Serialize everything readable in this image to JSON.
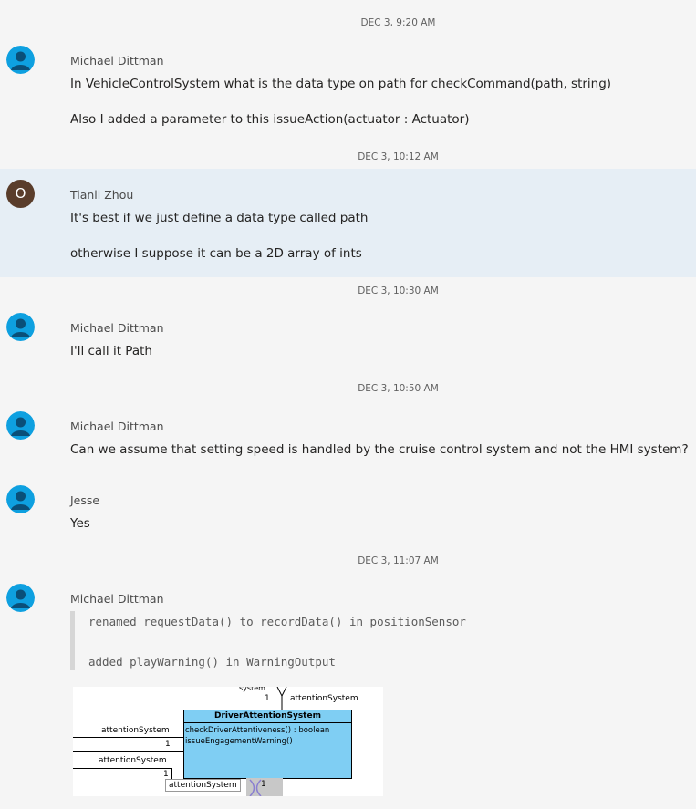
{
  "messages": [
    {
      "timestamp": "DEC 3, 9:20 AM",
      "author": "Michael Dittman",
      "lines": [
        "In VehicleControlSystem what is the data type on path for checkCommand(path, string)",
        "Also I added a parameter to this issueAction(actuator : Actuator)"
      ]
    },
    {
      "timestamp": "DEC 3, 10:12 AM",
      "author": "Tianli Zhou",
      "avatar_letter": "O",
      "lines": [
        "It's best if we just define a data type called path",
        "otherwise I suppose it can be a 2D array of ints"
      ]
    },
    {
      "timestamp": "DEC 3, 10:30 AM",
      "author": "Michael Dittman",
      "lines": [
        "I'll call it Path"
      ]
    },
    {
      "timestamp": "DEC 3, 10:50 AM",
      "author": "Michael Dittman",
      "lines": [
        "Can we assume that setting speed is handled by the cruise control system and not the HMI system?"
      ]
    },
    {
      "author": "Jesse",
      "lines": [
        "Yes"
      ]
    },
    {
      "timestamp": "DEC 3, 11:07 AM",
      "author": "Michael Dittman",
      "code_lines": [
        "renamed requestData() to recordData() in positionSensor",
        "added playWarning() in WarningOutput"
      ]
    }
  ],
  "uml": {
    "top_label": "system",
    "top_mult": "1",
    "top_role": "attentionSystem",
    "class_name": "DriverAttentionSystem",
    "methods": [
      "checkDriverAttentiveness() : boolean",
      "issueEngagementWarning()"
    ],
    "left_role_1": "attentionSystem",
    "left_mult_1": "1",
    "left_role_2": "attentionSystem",
    "left_mult_2": "1",
    "bottom_role": "attentionSystem",
    "bottom_mult": "1"
  },
  "colors": {
    "background": "#f5f5f5",
    "highlight": "#e6eef5",
    "avatar_default": "#0ea0e0",
    "avatar_letter_bg": "#5a3d2b",
    "uml_class_fill": "#7fcef3"
  }
}
